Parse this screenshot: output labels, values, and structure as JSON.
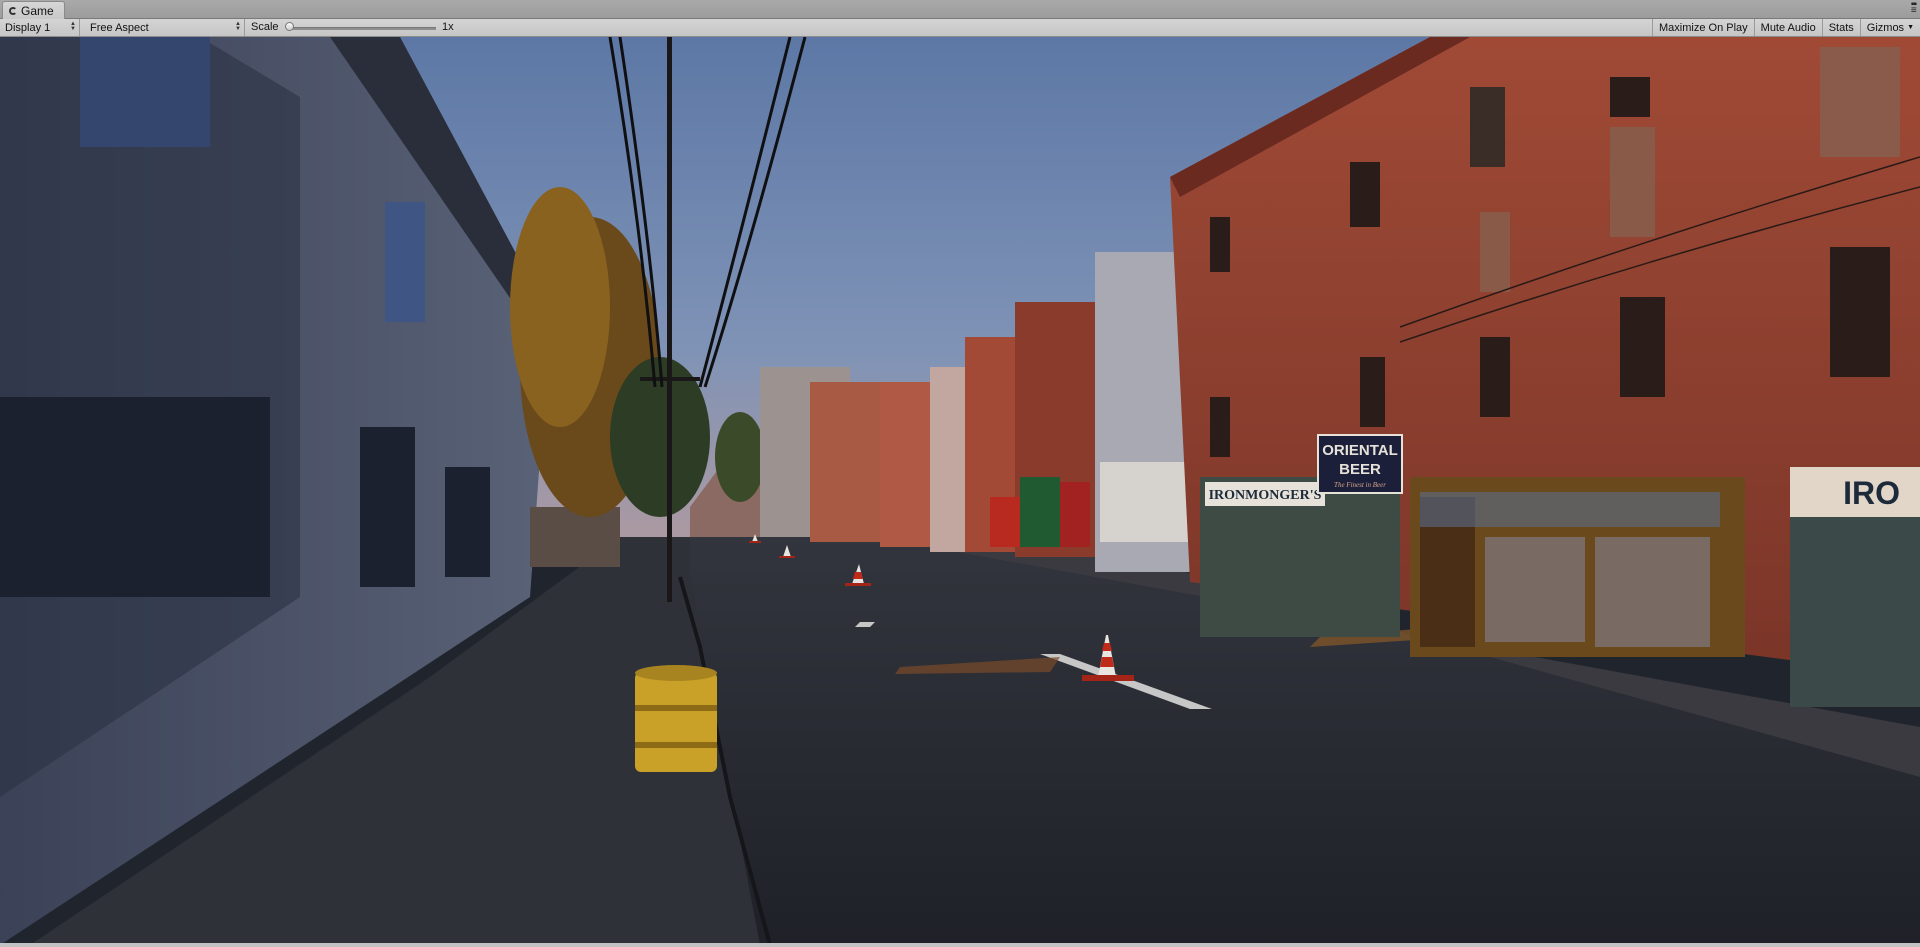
{
  "tab": {
    "title": "Game",
    "icon": "game-controller-icon"
  },
  "toolbar": {
    "display_value": "Display 1",
    "aspect_value": "Free Aspect",
    "scale_label": "Scale",
    "scale_value": "1x",
    "maximize_on_play": "Maximize On Play",
    "mute_audio": "Mute Audio",
    "stats": "Stats",
    "gizmos": "Gizmos"
  },
  "scene": {
    "signs": {
      "oriental_line1": "ORIENTAL",
      "oriental_line2": "BEER",
      "oriental_tagline": "The Finest in Beer",
      "ironmonger": "IRONMONGER'S",
      "iron_partial": "IRO"
    }
  }
}
